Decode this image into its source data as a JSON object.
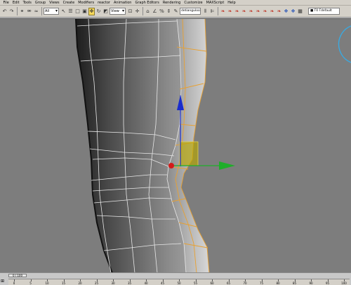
{
  "menubar": {
    "items": [
      "File",
      "Edit",
      "Tools",
      "Group",
      "Views",
      "Create",
      "Modifiers",
      "reactor",
      "Animation",
      "Graph Editors",
      "Rendering",
      "Customize",
      "MAXScript",
      "Help"
    ]
  },
  "toolbar": {
    "selection_filter": "All",
    "reference_coord": "View",
    "named_selection": "detianguloo",
    "right_field": "■ Γ0 Γdefault"
  },
  "timeline": {
    "frame_indicator": "0 / 100",
    "ticks": [
      "0",
      "5",
      "10",
      "15",
      "20",
      "25",
      "30",
      "35",
      "40",
      "45",
      "50",
      "55",
      "60",
      "65",
      "70",
      "75",
      "80",
      "85",
      "90",
      "95",
      "100"
    ]
  },
  "colors": {
    "viewport_bg": "#7d7d7d",
    "gizmo_z": "#1a2ccc",
    "gizmo_y": "#1fae2a",
    "gizmo_x": "#d41a1a",
    "selection_edge": "#e8a030",
    "plane_handle": "#c9b400"
  }
}
